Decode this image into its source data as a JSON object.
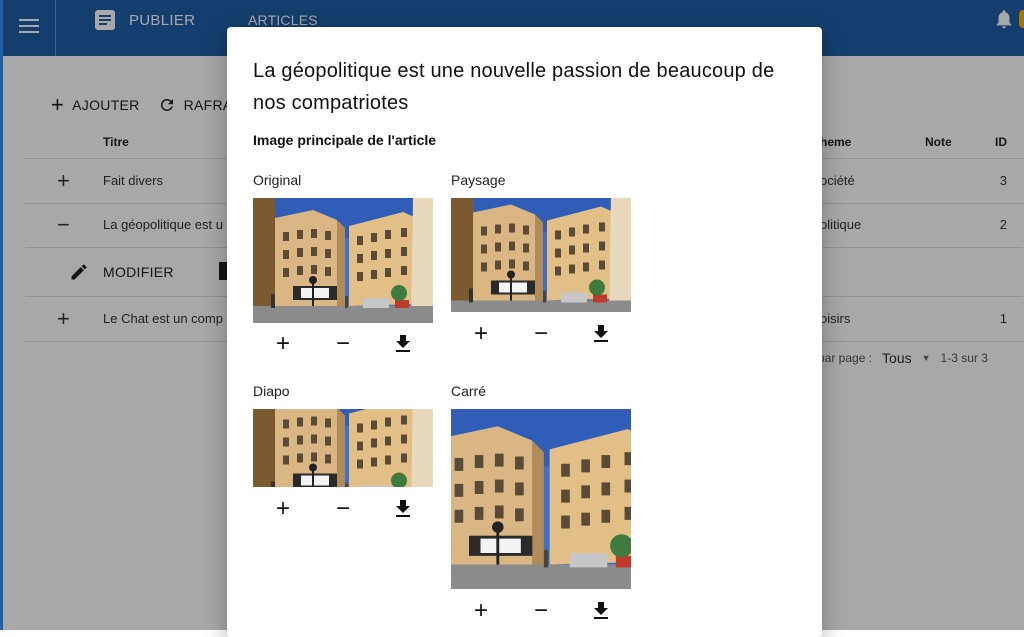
{
  "appbar": {
    "brand_label": "PUBLIER",
    "nav_articles": "ARTICLES"
  },
  "toolbar": {
    "add_label": "AJOUTER",
    "refresh_label": "RAFRA"
  },
  "table": {
    "headers": {
      "title": "Titre",
      "theme": "heme",
      "note": "Note",
      "id": "ID"
    },
    "rows": [
      {
        "expander": "+",
        "title": "Fait divers",
        "theme": "ociété",
        "id": "3"
      },
      {
        "expander": "−",
        "title": "La géopolitique est u",
        "theme": "olitique",
        "id": "2"
      },
      {
        "expander": "+",
        "title": "Le Chat est un comp",
        "theme": "oisirs",
        "id": "1"
      }
    ],
    "edit_label": "MODIFIER"
  },
  "pager": {
    "per_page_label": "par page :",
    "per_page_value": "Tous",
    "range": "1-3 sur 3"
  },
  "dialog": {
    "title": "La géopolitique est une nouvelle passion de beaucoup de nos compatriotes",
    "subtitle": "Image principale de l'article",
    "variants": [
      {
        "label": "Original"
      },
      {
        "label": "Paysage"
      },
      {
        "label": "Diapo"
      },
      {
        "label": "Carré"
      }
    ]
  },
  "colors": {
    "appbar": "#1f5fa6",
    "badge": "#f2b400"
  },
  "icons": [
    "menu-icon",
    "document-icon",
    "bell-icon",
    "plus-icon",
    "refresh-icon",
    "minus-icon",
    "pencil-icon",
    "image-icon",
    "dropdown-icon",
    "download-icon"
  ]
}
